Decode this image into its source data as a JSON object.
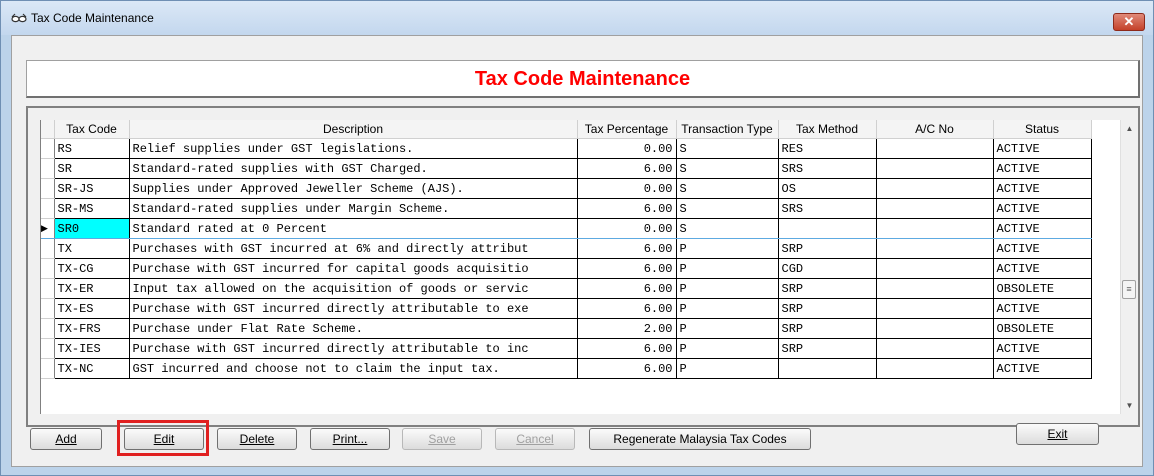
{
  "window": {
    "title": "Tax Code Maintenance",
    "close_label": "✕"
  },
  "header": {
    "title": "Tax Code Maintenance"
  },
  "table": {
    "columns": [
      "Tax Code",
      "Description",
      "Tax Percentage",
      "Transaction Type",
      "Tax Method",
      "A/C No",
      "Status"
    ],
    "rows": [
      [
        "RS",
        "Relief supplies under GST legislations.",
        "0.00",
        "S",
        "RES",
        "",
        "ACTIVE"
      ],
      [
        "SR",
        "Standard-rated supplies with GST Charged.",
        "6.00",
        "S",
        "SRS",
        "",
        "ACTIVE"
      ],
      [
        "SR-JS",
        "Supplies under Approved Jeweller Scheme (AJS).",
        "0.00",
        "S",
        "OS",
        "",
        "ACTIVE"
      ],
      [
        "SR-MS",
        "Standard-rated supplies under Margin Scheme.",
        "6.00",
        "S",
        "SRS",
        "",
        "ACTIVE"
      ],
      [
        "SR0",
        "Standard rated at 0 Percent",
        "0.00",
        "S",
        "",
        "",
        "ACTIVE"
      ],
      [
        "TX",
        "Purchases with GST incurred at 6% and directly attribut",
        "6.00",
        "P",
        "SRP",
        "",
        "ACTIVE"
      ],
      [
        "TX-CG",
        "Purchase with GST incurred for capital goods acquisitio",
        "6.00",
        "P",
        "CGD",
        "",
        "ACTIVE"
      ],
      [
        "TX-ER",
        "Input tax allowed on the acquisition of goods or servic",
        "6.00",
        "P",
        "SRP",
        "",
        "OBSOLETE"
      ],
      [
        "TX-ES",
        "Purchase with GST incurred directly attributable to exe",
        "6.00",
        "P",
        "SRP",
        "",
        "ACTIVE"
      ],
      [
        "TX-FRS",
        "Purchase under Flat Rate Scheme.",
        "2.00",
        "P",
        "SRP",
        "",
        "OBSOLETE"
      ],
      [
        "TX-IES",
        "Purchase with GST incurred directly attributable to inc",
        "6.00",
        "P",
        "SRP",
        "",
        "ACTIVE"
      ],
      [
        "TX-NC",
        "GST incurred and choose not to claim the input tax.",
        "6.00",
        "P",
        "",
        "",
        "ACTIVE"
      ]
    ],
    "current_row": 4,
    "current_indicator": "▶"
  },
  "buttons": {
    "add": "Add",
    "edit": "Edit",
    "delete": "Delete",
    "print": "Print...",
    "save": "Save",
    "cancel": "Cancel",
    "regenerate": "Regenerate Malaysia Tax Codes",
    "exit": "Exit"
  },
  "icons": {
    "title": "glasses-icon",
    "scroll_up": "scroll-up-arrow-icon",
    "scroll_down": "scroll-down-arrow-icon"
  }
}
